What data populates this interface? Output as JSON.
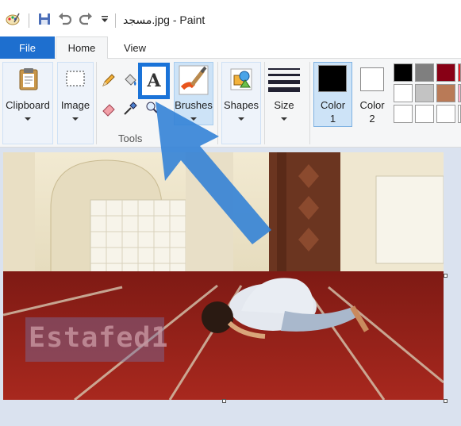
{
  "window": {
    "title": "مسجد.jpg - Paint"
  },
  "quick_access": {
    "icons": [
      "paint-app-icon",
      "save-icon",
      "undo-icon",
      "redo-icon",
      "customize-dropdown-icon"
    ]
  },
  "tabs": {
    "file": "File",
    "home": "Home",
    "view": "View"
  },
  "ribbon": {
    "clipboard_label": "Clipboard",
    "image_label": "Image",
    "tools_group_label": "Tools",
    "text_tool_glyph": "A",
    "brushes_label": "Brushes",
    "shapes_label": "Shapes",
    "size_label": "Size",
    "color1_label": "Color",
    "color1_num": "1",
    "color2_label": "Color",
    "color2_num": "2"
  },
  "colors": {
    "color1": "#000000",
    "color2": "#ffffff",
    "accent": "#1a73d8",
    "palette_row1": [
      "#000000",
      "#7f7f7f",
      "#880015",
      "#ed1c24"
    ],
    "palette_row2": [
      "#ffffff",
      "#c3c3c3",
      "#b97a57",
      "#ffaec9"
    ],
    "palette_row3": [
      "#ffffff",
      "#ffffff",
      "#ffffff",
      "#ffffff"
    ]
  },
  "canvas": {
    "watermark": "Estafed1"
  }
}
